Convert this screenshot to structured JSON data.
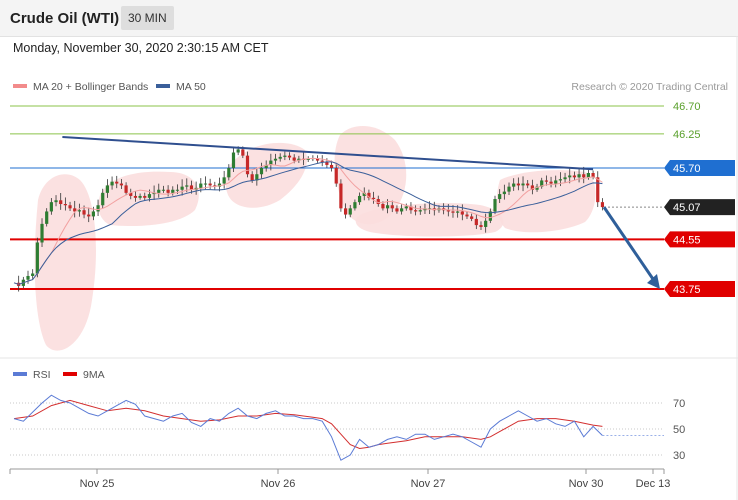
{
  "header": {
    "title": "Crude Oil (WTI)",
    "timeframe": "30 MIN",
    "timestamp": "Monday, November 30, 2020 2:30:15 AM CET"
  },
  "chart_data": {
    "type": "candlestick",
    "legend": [
      {
        "label": "MA 20 + Bollinger Bands",
        "color": "#f28b8b"
      },
      {
        "label": "MA 50",
        "color": "#3a5f9a"
      }
    ],
    "credit": "Research © 2020 Trading Central",
    "price_axis": {
      "min": 43.37,
      "max": 46.85
    },
    "levels": [
      {
        "value": 46.7,
        "label": "46.70",
        "kind": "target",
        "color": "#5aa02c"
      },
      {
        "value": 46.25,
        "label": "46.25",
        "kind": "target",
        "color": "#5aa02c"
      },
      {
        "value": 45.7,
        "label": "45.70",
        "kind": "pivot",
        "color": "#1f6fd1"
      },
      {
        "value": 45.07,
        "label": "45.07",
        "kind": "last_price",
        "color": "#222222"
      },
      {
        "value": 44.55,
        "label": "44.55",
        "kind": "support",
        "color": "#e00000"
      },
      {
        "value": 43.75,
        "label": "43.75",
        "kind": "support",
        "color": "#e00000"
      }
    ],
    "x_labels": [
      "Nov 25",
      "Nov 26",
      "Nov 27",
      "Nov 30",
      "Dec 13"
    ],
    "trendline": {
      "from": [
        9.5,
        46.2
      ],
      "to": [
        124,
        45.68
      ]
    },
    "forecast_arrow": {
      "from": [
        126,
        45.07
      ],
      "to": [
        138,
        43.75
      ]
    },
    "price_path": [
      [
        0,
        43.85
      ],
      [
        1,
        43.8
      ],
      [
        2,
        43.9
      ],
      [
        3,
        43.96
      ],
      [
        4,
        44.0
      ],
      [
        5,
        44.5
      ],
      [
        6,
        44.8
      ],
      [
        7,
        45.0
      ],
      [
        8,
        45.15
      ],
      [
        9,
        45.18
      ],
      [
        10,
        45.12
      ],
      [
        11,
        45.1
      ],
      [
        12,
        45.05
      ],
      [
        13,
        45.0
      ],
      [
        14,
        45.02
      ],
      [
        15,
        44.95
      ],
      [
        16,
        44.92
      ],
      [
        17,
        45.0
      ],
      [
        18,
        45.1
      ],
      [
        19,
        45.3
      ],
      [
        20,
        45.42
      ],
      [
        21,
        45.48
      ],
      [
        22,
        45.45
      ],
      [
        23,
        45.42
      ],
      [
        24,
        45.3
      ],
      [
        25,
        45.25
      ],
      [
        26,
        45.22
      ],
      [
        27,
        45.25
      ],
      [
        28,
        45.22
      ],
      [
        29,
        45.28
      ],
      [
        30,
        45.3
      ],
      [
        31,
        45.35
      ],
      [
        32,
        45.35
      ],
      [
        33,
        45.3
      ],
      [
        34,
        45.35
      ],
      [
        35,
        45.35
      ],
      [
        36,
        45.4
      ],
      [
        37,
        45.42
      ],
      [
        38,
        45.35
      ],
      [
        39,
        45.38
      ],
      [
        40,
        45.45
      ],
      [
        41,
        45.45
      ],
      [
        42,
        45.42
      ],
      [
        43,
        45.4
      ],
      [
        44,
        45.45
      ],
      [
        45,
        45.55
      ],
      [
        46,
        45.7
      ],
      [
        47,
        45.95
      ],
      [
        48,
        46.0
      ],
      [
        49,
        45.9
      ],
      [
        50,
        45.6
      ],
      [
        51,
        45.5
      ],
      [
        52,
        45.6
      ],
      [
        53,
        45.7
      ],
      [
        54,
        45.75
      ],
      [
        55,
        45.82
      ],
      [
        56,
        45.85
      ],
      [
        57,
        45.88
      ],
      [
        58,
        45.9
      ],
      [
        59,
        45.87
      ],
      [
        60,
        45.82
      ],
      [
        61,
        45.85
      ],
      [
        62,
        45.83
      ],
      [
        63,
        45.85
      ],
      [
        64,
        45.86
      ],
      [
        65,
        45.82
      ],
      [
        66,
        45.8
      ],
      [
        67,
        45.75
      ],
      [
        68,
        45.7
      ],
      [
        69,
        45.45
      ],
      [
        70,
        45.05
      ],
      [
        71,
        44.95
      ],
      [
        72,
        45.05
      ],
      [
        73,
        45.15
      ],
      [
        74,
        45.25
      ],
      [
        75,
        45.3
      ],
      [
        76,
        45.22
      ],
      [
        77,
        45.2
      ],
      [
        78,
        45.12
      ],
      [
        79,
        45.05
      ],
      [
        80,
        45.1
      ],
      [
        81,
        45.05
      ],
      [
        82,
        45.0
      ],
      [
        83,
        45.05
      ],
      [
        84,
        45.08
      ],
      [
        85,
        45.02
      ],
      [
        86,
        45.0
      ],
      [
        87,
        45.02
      ],
      [
        88,
        45.05
      ],
      [
        89,
        45.05
      ],
      [
        90,
        45.02
      ],
      [
        91,
        45.05
      ],
      [
        92,
        45.02
      ],
      [
        93,
        45.0
      ],
      [
        94,
        44.98
      ],
      [
        95,
        45.0
      ],
      [
        96,
        44.95
      ],
      [
        97,
        44.92
      ],
      [
        98,
        44.88
      ],
      [
        99,
        44.78
      ],
      [
        100,
        44.75
      ],
      [
        101,
        44.85
      ],
      [
        102,
        45.0
      ],
      [
        103,
        45.2
      ],
      [
        104,
        45.28
      ],
      [
        105,
        45.32
      ],
      [
        106,
        45.4
      ],
      [
        107,
        45.45
      ],
      [
        108,
        45.42
      ],
      [
        109,
        45.45
      ],
      [
        110,
        45.42
      ],
      [
        111,
        45.35
      ],
      [
        112,
        45.4
      ],
      [
        113,
        45.5
      ],
      [
        114,
        45.48
      ],
      [
        115,
        45.45
      ],
      [
        116,
        45.5
      ],
      [
        117,
        45.52
      ],
      [
        118,
        45.55
      ],
      [
        119,
        45.58
      ],
      [
        120,
        45.55
      ],
      [
        121,
        45.6
      ],
      [
        122,
        45.55
      ],
      [
        123,
        45.62
      ],
      [
        124,
        45.55
      ],
      [
        125,
        45.15
      ],
      [
        126,
        45.07
      ]
    ]
  },
  "rsi_chart": {
    "legend": [
      {
        "label": "RSI",
        "color": "#5b7bd5"
      },
      {
        "label": "9MA",
        "color": "#e00000"
      }
    ],
    "y_labels": [
      "70",
      "50",
      "30"
    ],
    "y_range": [
      20,
      80
    ],
    "last_value": 45,
    "rsi": [
      [
        0,
        58
      ],
      [
        2,
        56
      ],
      [
        4,
        63
      ],
      [
        6,
        70
      ],
      [
        8,
        76
      ],
      [
        10,
        72
      ],
      [
        12,
        70
      ],
      [
        14,
        66
      ],
      [
        16,
        62
      ],
      [
        18,
        60
      ],
      [
        20,
        64
      ],
      [
        22,
        68
      ],
      [
        24,
        72
      ],
      [
        26,
        69
      ],
      [
        28,
        60
      ],
      [
        30,
        58
      ],
      [
        32,
        56
      ],
      [
        34,
        60
      ],
      [
        36,
        62
      ],
      [
        38,
        55
      ],
      [
        40,
        52
      ],
      [
        42,
        58
      ],
      [
        44,
        56
      ],
      [
        46,
        62
      ],
      [
        48,
        66
      ],
      [
        50,
        60
      ],
      [
        52,
        58
      ],
      [
        54,
        62
      ],
      [
        56,
        64
      ],
      [
        58,
        60
      ],
      [
        60,
        60
      ],
      [
        62,
        58
      ],
      [
        64,
        58
      ],
      [
        66,
        56
      ],
      [
        68,
        44
      ],
      [
        70,
        26
      ],
      [
        72,
        30
      ],
      [
        74,
        42
      ],
      [
        76,
        36
      ],
      [
        78,
        38
      ],
      [
        80,
        42
      ],
      [
        82,
        44
      ],
      [
        84,
        42
      ],
      [
        86,
        46
      ],
      [
        88,
        46
      ],
      [
        90,
        42
      ],
      [
        92,
        44
      ],
      [
        94,
        46
      ],
      [
        96,
        44
      ],
      [
        98,
        40
      ],
      [
        100,
        36
      ],
      [
        102,
        50
      ],
      [
        104,
        56
      ],
      [
        106,
        60
      ],
      [
        108,
        64
      ],
      [
        110,
        60
      ],
      [
        112,
        56
      ],
      [
        114,
        58
      ],
      [
        116,
        54
      ],
      [
        118,
        52
      ],
      [
        120,
        56
      ],
      [
        122,
        44
      ],
      [
        124,
        52
      ],
      [
        126,
        45
      ]
    ],
    "ma": [
      [
        0,
        58
      ],
      [
        4,
        60
      ],
      [
        8,
        68
      ],
      [
        12,
        72
      ],
      [
        16,
        68
      ],
      [
        20,
        64
      ],
      [
        24,
        66
      ],
      [
        28,
        64
      ],
      [
        32,
        60
      ],
      [
        36,
        58
      ],
      [
        40,
        56
      ],
      [
        44,
        57
      ],
      [
        48,
        60
      ],
      [
        52,
        60
      ],
      [
        56,
        62
      ],
      [
        60,
        61
      ],
      [
        64,
        59
      ],
      [
        66,
        58
      ],
      [
        68,
        54
      ],
      [
        70,
        46
      ],
      [
        72,
        38
      ],
      [
        74,
        35
      ],
      [
        76,
        36
      ],
      [
        78,
        38
      ],
      [
        80,
        39
      ],
      [
        84,
        41
      ],
      [
        88,
        44
      ],
      [
        92,
        44
      ],
      [
        96,
        44
      ],
      [
        100,
        42
      ],
      [
        102,
        44
      ],
      [
        104,
        48
      ],
      [
        106,
        52
      ],
      [
        108,
        56
      ],
      [
        112,
        58
      ],
      [
        116,
        58
      ],
      [
        120,
        56
      ],
      [
        124,
        53
      ],
      [
        126,
        52
      ]
    ]
  }
}
